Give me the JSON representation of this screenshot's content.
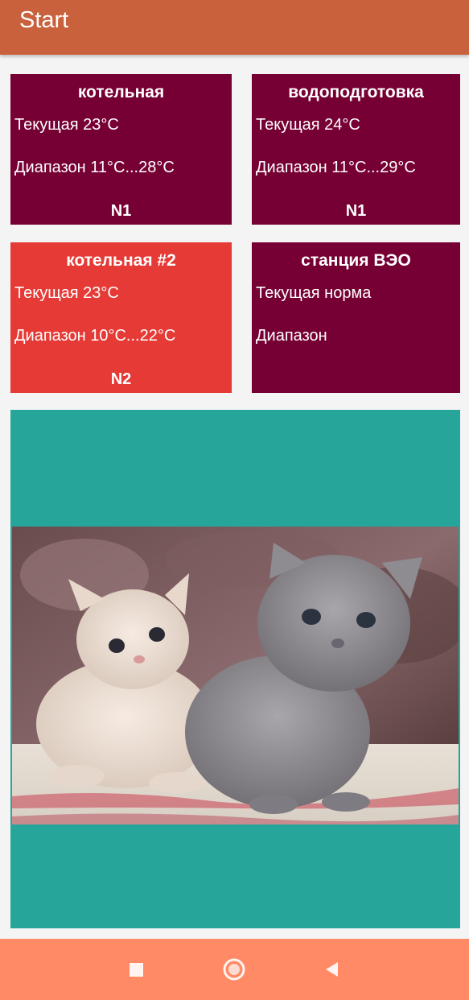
{
  "app_bar": {
    "title": "Start",
    "color": "#c8613c"
  },
  "cards": [
    {
      "title": "котельная",
      "current": "Текущая 23°C",
      "range": "Диапазон 11°C...28°C",
      "footer": "N1",
      "color": "#760033"
    },
    {
      "title": "водоподготовка",
      "current": "Текущая 24°C",
      "range": "Диапазон 11°C...29°C",
      "footer": "N1",
      "color": "#760033"
    },
    {
      "title": "котельная #2",
      "current": "Текущая 23°C",
      "range": "Диапазон 10°C...22°C",
      "footer": "N2",
      "color": "#e53a35"
    },
    {
      "title": "станция ВЭО",
      "current": "Текущая норма",
      "range": "Диапазон",
      "footer": "",
      "color": "#760033"
    }
  ],
  "photo_panel": {
    "background": "#26a69a",
    "image_subject": "two-kittens"
  },
  "nav_bar": {
    "color": "#ff8a65",
    "buttons": [
      "recents-square-icon",
      "home-circle-icon",
      "back-triangle-icon"
    ]
  }
}
